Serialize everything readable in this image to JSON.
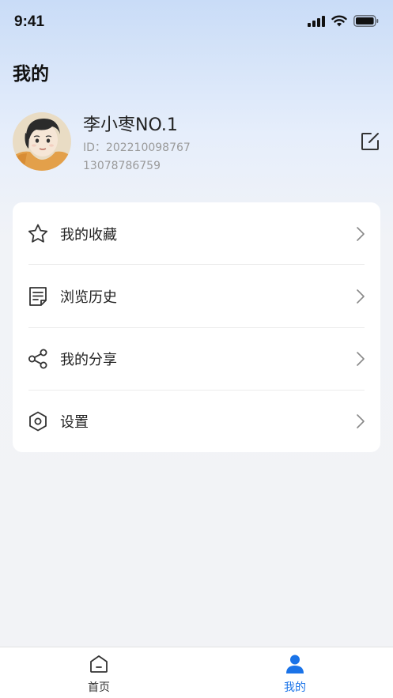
{
  "status_bar": {
    "time": "9:41"
  },
  "header": {
    "title": "我的"
  },
  "profile": {
    "name": "李小枣NO.1",
    "id_text": "ID：202210098767",
    "phone": "13078786759"
  },
  "menu": {
    "items": [
      {
        "label": "我的收藏",
        "icon": "star-icon"
      },
      {
        "label": "浏览历史",
        "icon": "document-icon"
      },
      {
        "label": "我的分享",
        "icon": "share-icon"
      },
      {
        "label": "设置",
        "icon": "settings-hexagon-icon"
      }
    ]
  },
  "tab_bar": {
    "tabs": [
      {
        "label": "首页",
        "icon": "home-icon",
        "active": false
      },
      {
        "label": "我的",
        "icon": "person-icon",
        "active": true
      }
    ],
    "active_color": "#1a73e8",
    "inactive_color": "#333333"
  }
}
